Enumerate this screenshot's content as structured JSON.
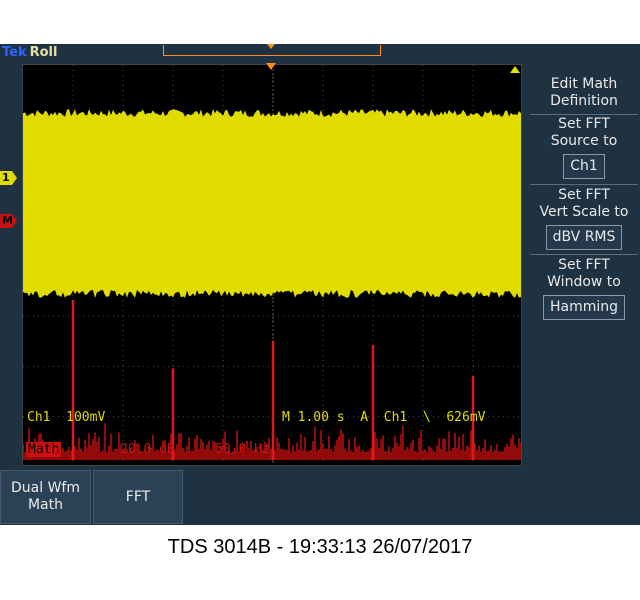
{
  "brand": {
    "tek": "Tek",
    "mode": "Roll"
  },
  "markers": {
    "ch1": "1",
    "math": "M"
  },
  "readouts": {
    "ch1": "Ch1  100mV",
    "timebase": "M 1.00 s  A  Ch1  \\  626mV",
    "math_label": "Math",
    "math_scale": "20.0 dB",
    "math_freq": "50.0 Hz"
  },
  "side_menu": {
    "title": [
      "Edit Math",
      "Definition"
    ],
    "fft_source": {
      "label": [
        "Set FFT",
        "Source to"
      ],
      "value": "Ch1"
    },
    "fft_scale": {
      "label": [
        "Set FFT",
        "Vert Scale to"
      ],
      "value": "dBV RMS"
    },
    "fft_window": {
      "label": [
        "Set FFT",
        "Window to"
      ],
      "value": "Hamming"
    }
  },
  "bottom_menu": {
    "dual_wfm": [
      "Dual Wfm",
      "Math"
    ],
    "fft": "FFT"
  },
  "caption": "TDS 3014B - 19:33:13   26/07/2017",
  "colors": {
    "ch1": "#e1dc00",
    "math": "#cc1010",
    "trigger": "#ff8a1e",
    "panel": "#1f3242",
    "graticule_bg": "#000000"
  },
  "fft_peaks_fraction": [
    {
      "x": 0.1,
      "h": 0.82
    },
    {
      "x": 0.3,
      "h": 0.47
    },
    {
      "x": 0.5,
      "h": 0.61
    },
    {
      "x": 0.7,
      "h": 0.59
    },
    {
      "x": 0.9,
      "h": 0.43
    }
  ]
}
